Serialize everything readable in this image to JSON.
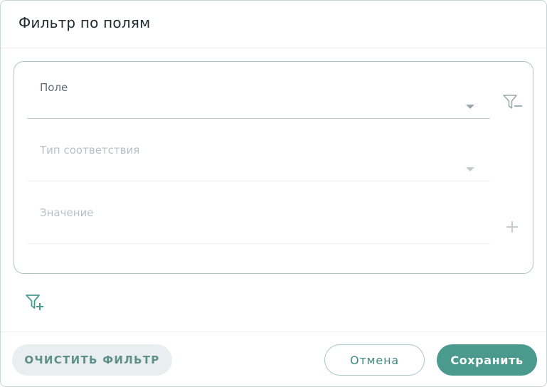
{
  "dialog": {
    "title": "Фильтр по полям"
  },
  "filter": {
    "field": {
      "label": "Поле",
      "value": ""
    },
    "match_type": {
      "label": "Тип соответствия",
      "value": ""
    },
    "value": {
      "label": "Значение",
      "value": ""
    }
  },
  "icons": {
    "remove_filter": "filter-minus-icon",
    "add_value": "plus-icon",
    "add_filter": "filter-plus-icon"
  },
  "footer": {
    "clear_label": "ОЧИСТИТЬ ФИЛЬТР",
    "cancel_label": "Отмена",
    "save_label": "Сохранить"
  },
  "colors": {
    "accent": "#4a9b8e",
    "accent_text": "#3f8a80",
    "border": "#a9c7c3",
    "clear_bg": "#e9eff0"
  }
}
